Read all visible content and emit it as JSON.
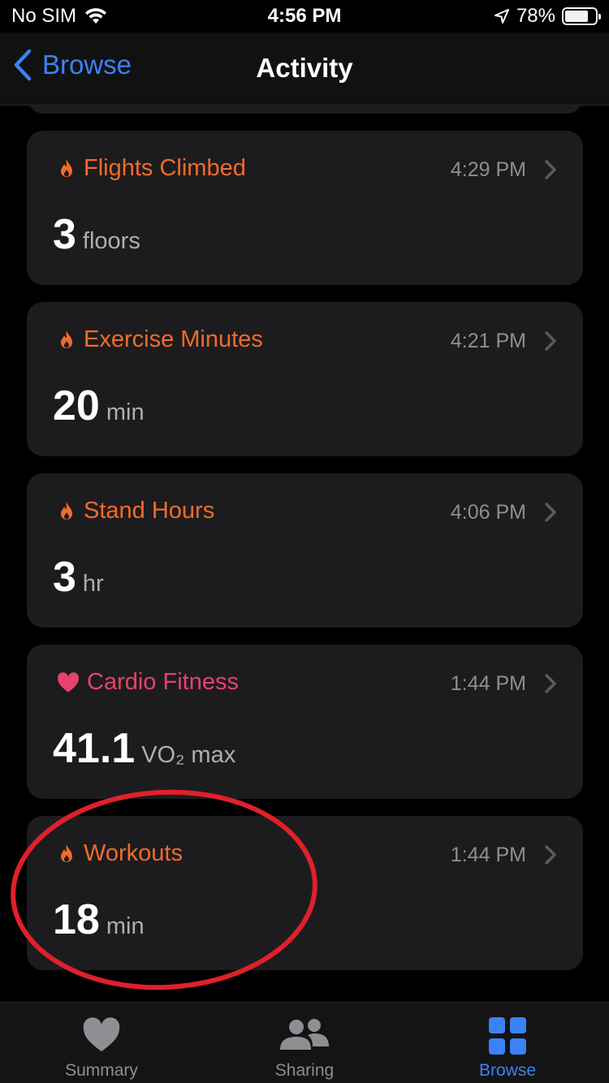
{
  "status_bar": {
    "carrier": "No SIM",
    "time": "4:56 PM",
    "battery": "78%",
    "battery_level": 0.78
  },
  "nav": {
    "back_label": "Browse",
    "title": "Activity"
  },
  "cards": [
    {
      "title": "Flights Climbed",
      "time": "4:29 PM",
      "value": "3",
      "unit": "floors",
      "icon": "flame-icon",
      "color": "#f26b2a"
    },
    {
      "title": "Exercise Minutes",
      "time": "4:21 PM",
      "value": "20",
      "unit": "min",
      "icon": "flame-icon",
      "color": "#f26b2a"
    },
    {
      "title": "Stand Hours",
      "time": "4:06 PM",
      "value": "3",
      "unit": "hr",
      "icon": "flame-icon",
      "color": "#f26b2a"
    },
    {
      "title": "Cardio Fitness",
      "time": "1:44 PM",
      "value": "41.1",
      "unit": "VO₂ max",
      "icon": "heart-icon",
      "color": "#e8416b"
    },
    {
      "title": "Workouts",
      "time": "1:44 PM",
      "value": "18",
      "unit": "min",
      "icon": "flame-icon",
      "color": "#f26b2a"
    }
  ],
  "tabs": [
    {
      "label": "Summary",
      "icon": "heart-icon",
      "active": false
    },
    {
      "label": "Sharing",
      "icon": "people-icon",
      "active": false
    },
    {
      "label": "Browse",
      "icon": "grid-icon",
      "active": true
    }
  ],
  "colors": {
    "accent_blue": "#3b82f6",
    "activity_orange": "#f26b2a",
    "heart_pink": "#e8416b",
    "annotation_red": "#e0202a"
  }
}
